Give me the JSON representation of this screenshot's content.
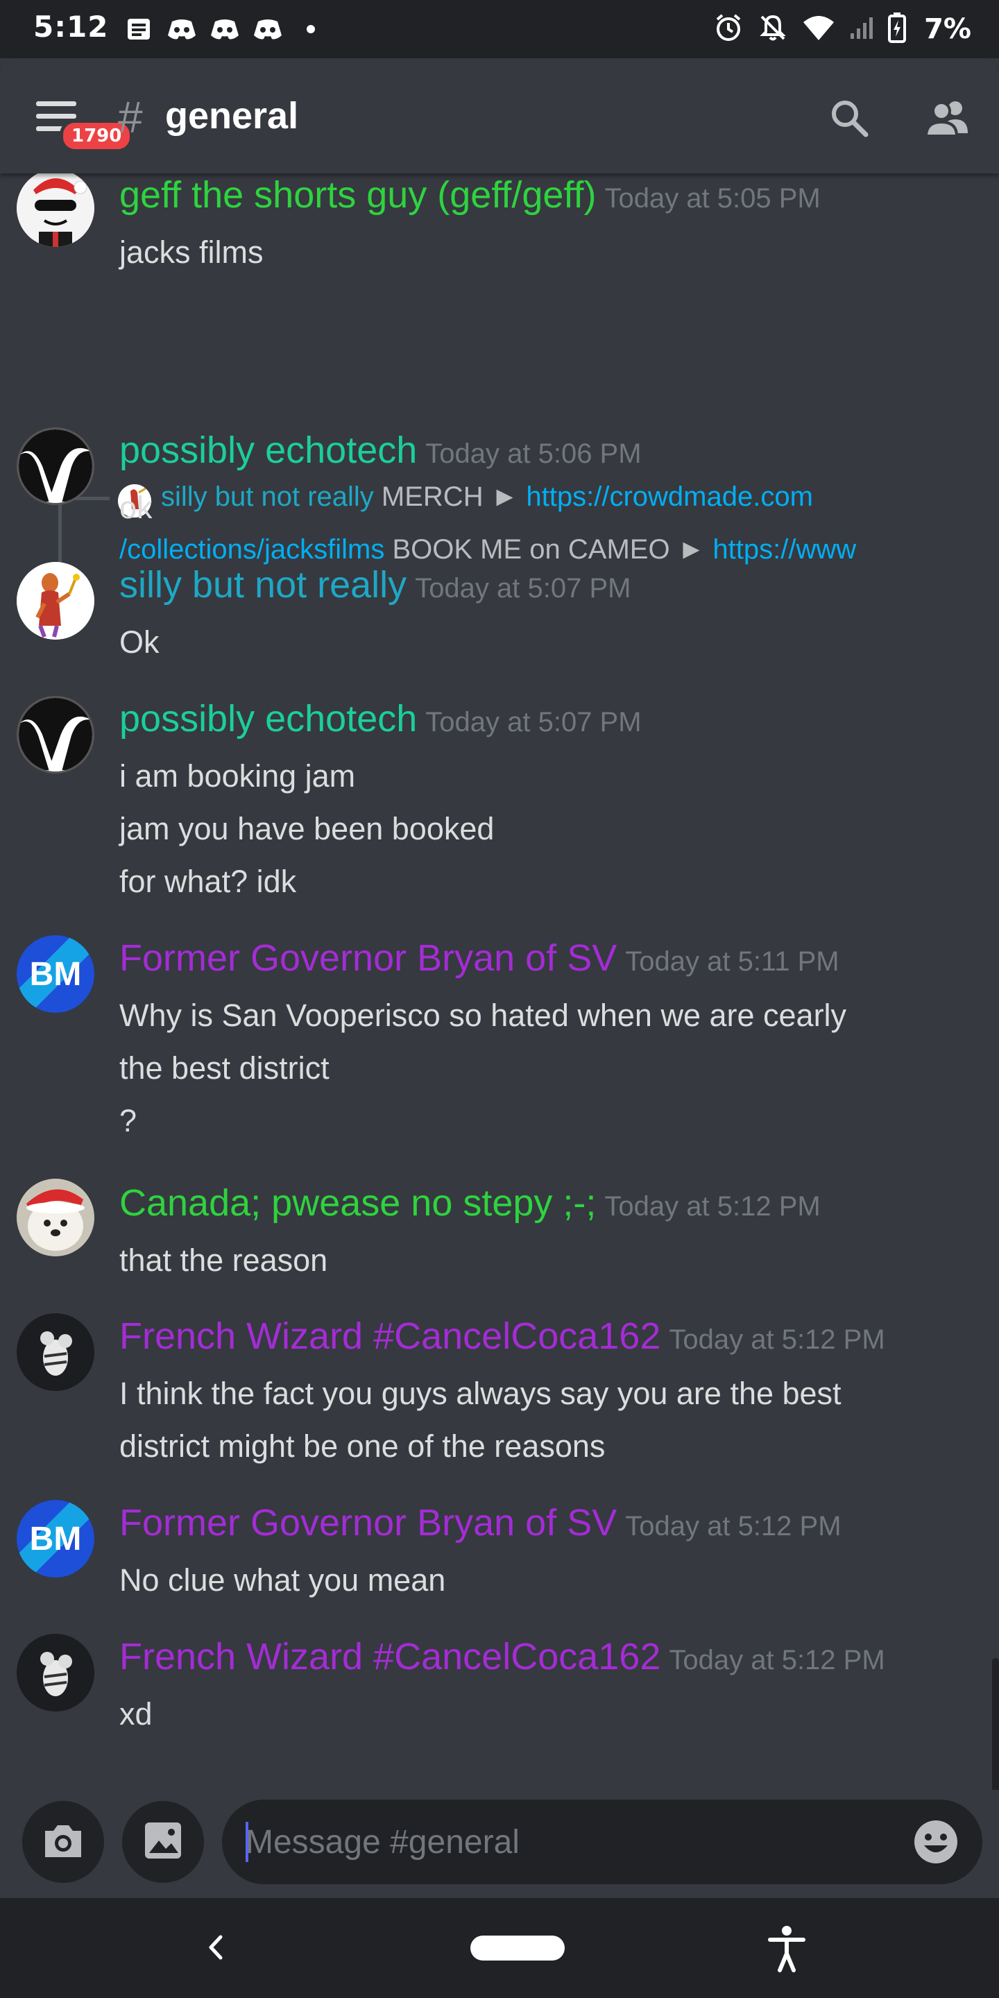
{
  "status_bar": {
    "time": "5:12",
    "battery": "7%",
    "left_icons": [
      "news-icon",
      "discord-icon",
      "discord-icon",
      "discord-icon",
      "dot-icon"
    ],
    "right_icons": [
      "alarm-icon",
      "notifications-off-icon",
      "wifi-icon",
      "signal-icon",
      "battery-charging-icon"
    ]
  },
  "header": {
    "hash": "#",
    "channel": "general",
    "badge": "1790",
    "search_icon": "search-icon",
    "members_icon": "members-icon"
  },
  "colors": {
    "background": "#36393f",
    "header_bg": "#202225",
    "text": "#dcddde",
    "timestamp": "#72767d",
    "link": "#00aff4",
    "green": "#2ed33f",
    "teal": "#1bcf9a",
    "cyan": "#1ea8c6",
    "purple": "#a42cd6",
    "badge": "#ed4245"
  },
  "messages": [
    {
      "user": "geff the shorts guy (geff/geff)",
      "time": "Today at 5:05 PM",
      "lines": [
        "jacks films"
      ]
    },
    {
      "user": "possibly echotech",
      "time": "Today at 5:06 PM",
      "lines": [
        "ok"
      ]
    },
    {
      "user": "silly but not really",
      "time": "Today at 5:07 PM",
      "lines": [
        "Ok"
      ]
    },
    {
      "user": "possibly echotech",
      "time": "Today at 5:07 PM",
      "lines": [
        "i am booking jam",
        "jam you have been booked",
        "for what? idk"
      ]
    },
    {
      "user": "Former Governor Bryan of SV",
      "time": "Today at 5:11 PM",
      "lines": [
        "Why is San Vooperisco so hated when we are cearly",
        "the best district",
        "?"
      ]
    },
    {
      "user": "Canada; pwease no stepy ;-;",
      "time": "Today at 5:12 PM",
      "lines": [
        "that the reason"
      ]
    },
    {
      "user": "French Wizard #CancelCoca162",
      "time": "Today at 5:12 PM",
      "lines": [
        "I think the fact you guys always say you are the best",
        "district might be one of the reasons"
      ]
    },
    {
      "user": "Former Governor Bryan of SV",
      "time": "Today at 5:12 PM",
      "lines": [
        "No clue what you mean"
      ]
    },
    {
      "user": "French Wizard #CancelCoca162",
      "time": "Today at 5:12 PM",
      "lines": [
        "xd"
      ]
    }
  ],
  "reply": {
    "user": "silly but not really",
    "merch_label": "MERCH ►",
    "link1": "https://crowdmade.com",
    "link1_cont": "/collections/jacksfilms",
    "cameo_label": "BOOK ME on CAMEO ►",
    "link2": "https://www"
  },
  "composer": {
    "placeholder": "Message #general",
    "camera_icon": "camera-icon",
    "image_icon": "image-icon",
    "emoji_icon": "emoji-icon"
  },
  "nav": {
    "back_icon": "back-icon",
    "home_icon": "home-pill-icon",
    "accessibility_icon": "accessibility-icon"
  }
}
